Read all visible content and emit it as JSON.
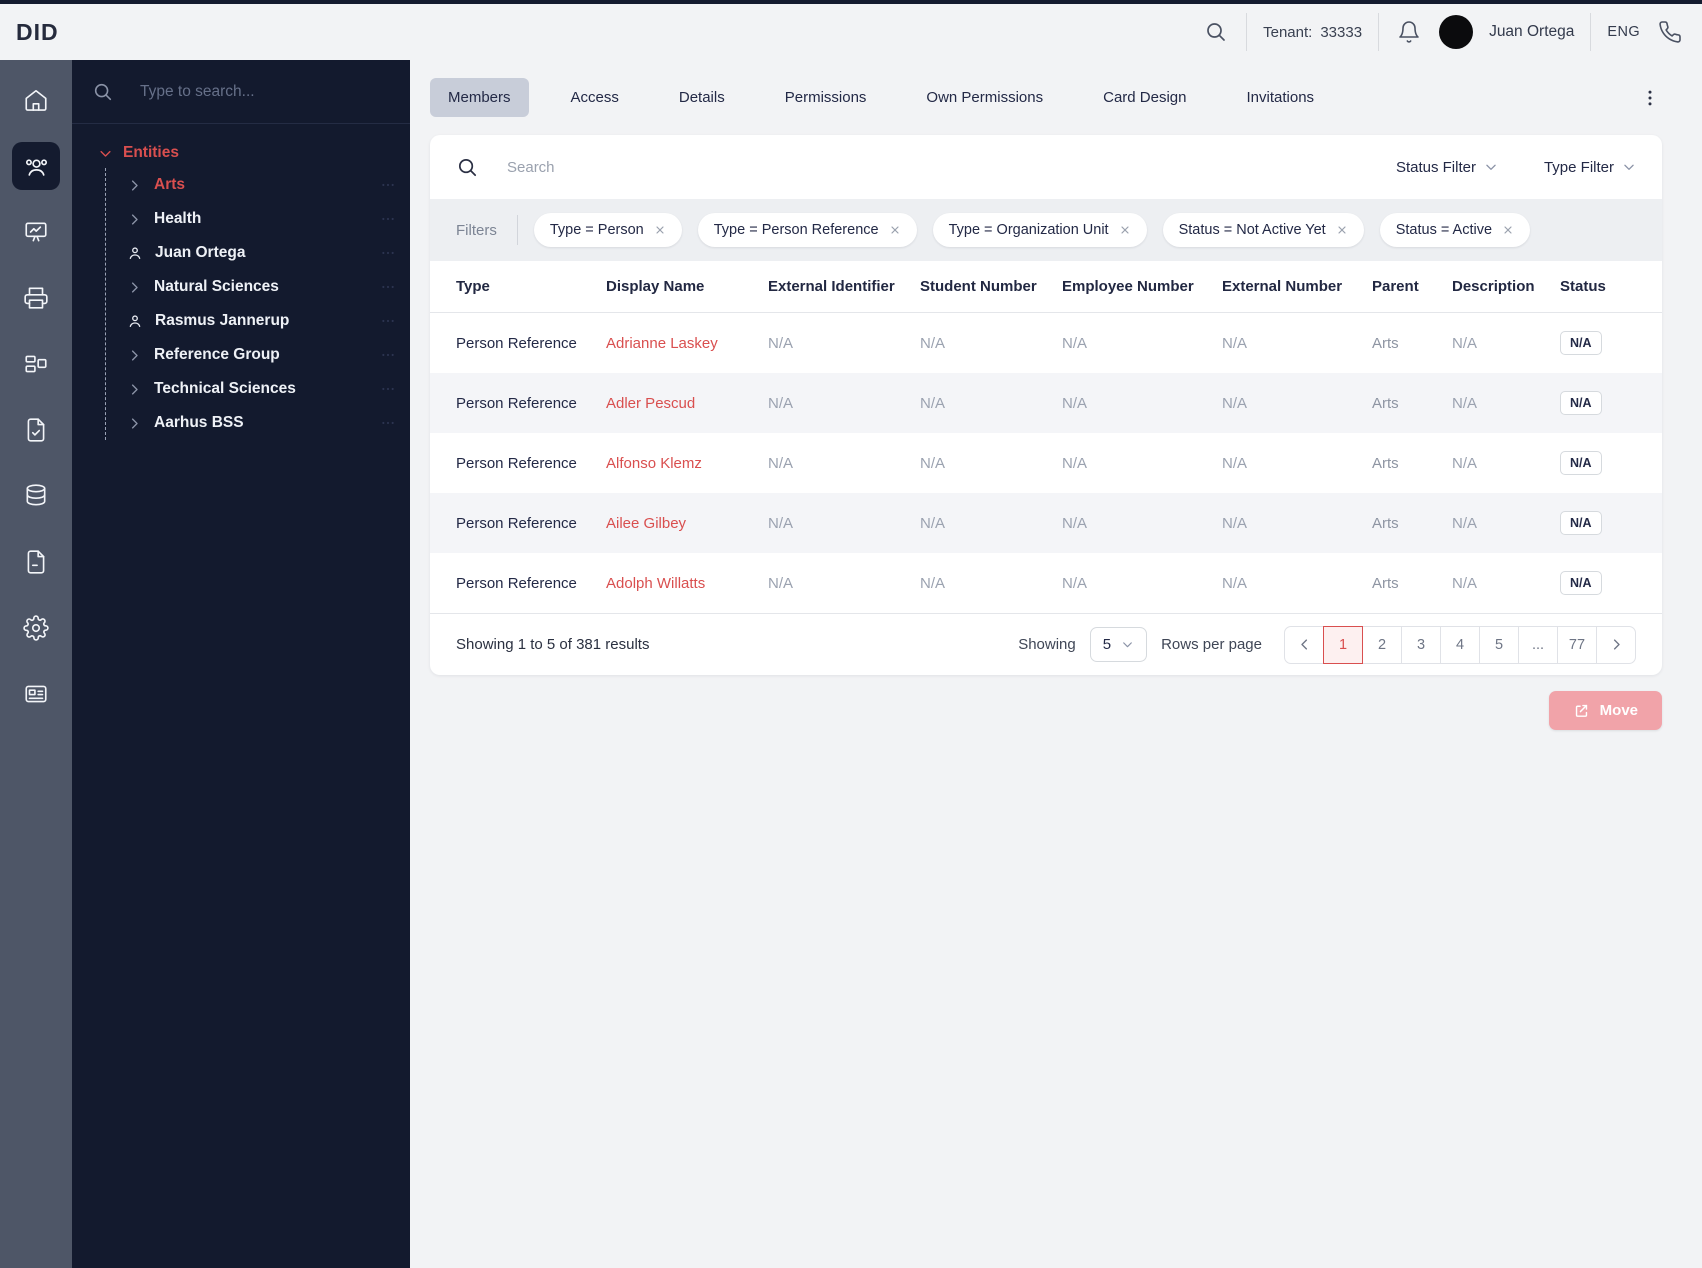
{
  "header": {
    "logo": "DID",
    "tenant_label": "Tenant:",
    "tenant_value": "33333",
    "user_name": "Juan Ortega",
    "language": "ENG"
  },
  "nav": {
    "search_placeholder": "Type to search...",
    "tree": {
      "root_label": "Entities",
      "items": [
        {
          "label": "Arts",
          "type": "group",
          "selected": true
        },
        {
          "label": "Health",
          "type": "group",
          "selected": false
        },
        {
          "label": "Juan Ortega",
          "type": "person",
          "selected": false
        },
        {
          "label": "Natural Sciences",
          "type": "group",
          "selected": false
        },
        {
          "label": "Rasmus Jannerup",
          "type": "person",
          "selected": false
        },
        {
          "label": "Reference Group",
          "type": "group",
          "selected": false
        },
        {
          "label": "Technical Sciences",
          "type": "group",
          "selected": false
        },
        {
          "label": "Aarhus BSS",
          "type": "group",
          "selected": false
        }
      ]
    }
  },
  "tabs": {
    "items": [
      "Members",
      "Access",
      "Details",
      "Permissions",
      "Own Permissions",
      "Card Design",
      "Invitations"
    ],
    "active": "Members"
  },
  "toolbar": {
    "search_placeholder": "Search",
    "status_filter_label": "Status Filter",
    "type_filter_label": "Type Filter"
  },
  "filters": {
    "label": "Filters",
    "chips": [
      {
        "text": "Type = Person"
      },
      {
        "text": "Type = Person Reference"
      },
      {
        "text": "Type = Organization Unit"
      },
      {
        "text": "Status = Not Active Yet"
      },
      {
        "text": "Status = Active"
      }
    ]
  },
  "table": {
    "columns": [
      "Type",
      "Display Name",
      "External Identifier",
      "Student Number",
      "Employee Number",
      "External Number",
      "Parent",
      "Description",
      "Status"
    ],
    "rows": [
      {
        "type": "Person Reference",
        "display_name": "Adrianne Laskey",
        "external_identifier": "N/A",
        "student_number": "N/A",
        "employee_number": "N/A",
        "external_number": "N/A",
        "parent": "Arts",
        "description": "N/A",
        "status": "N/A"
      },
      {
        "type": "Person Reference",
        "display_name": "Adler Pescud",
        "external_identifier": "N/A",
        "student_number": "N/A",
        "employee_number": "N/A",
        "external_number": "N/A",
        "parent": "Arts",
        "description": "N/A",
        "status": "N/A"
      },
      {
        "type": "Person Reference",
        "display_name": "Alfonso Klemz",
        "external_identifier": "N/A",
        "student_number": "N/A",
        "employee_number": "N/A",
        "external_number": "N/A",
        "parent": "Arts",
        "description": "N/A",
        "status": "N/A"
      },
      {
        "type": "Person Reference",
        "display_name": "Ailee Gilbey",
        "external_identifier": "N/A",
        "student_number": "N/A",
        "employee_number": "N/A",
        "external_number": "N/A",
        "parent": "Arts",
        "description": "N/A",
        "status": "N/A"
      },
      {
        "type": "Person Reference",
        "display_name": "Adolph Willatts",
        "external_identifier": "N/A",
        "student_number": "N/A",
        "employee_number": "N/A",
        "external_number": "N/A",
        "parent": "Arts",
        "description": "N/A",
        "status": "N/A"
      }
    ]
  },
  "pagination": {
    "summary": "Showing 1 to 5 of 381 results",
    "showing_label": "Showing",
    "rows_per_page_value": "5",
    "rows_per_page_label": "Rows per page",
    "pages": [
      "1",
      "2",
      "3",
      "4",
      "5",
      "...",
      "77"
    ],
    "active_page": "1"
  },
  "actions": {
    "move_label": "Move"
  },
  "colors": {
    "accent_red": "#d94f4f",
    "sidebar_dark": "#131a2e",
    "rail_slate": "#4e5667",
    "tab_active_bg": "#c8cdd9"
  }
}
